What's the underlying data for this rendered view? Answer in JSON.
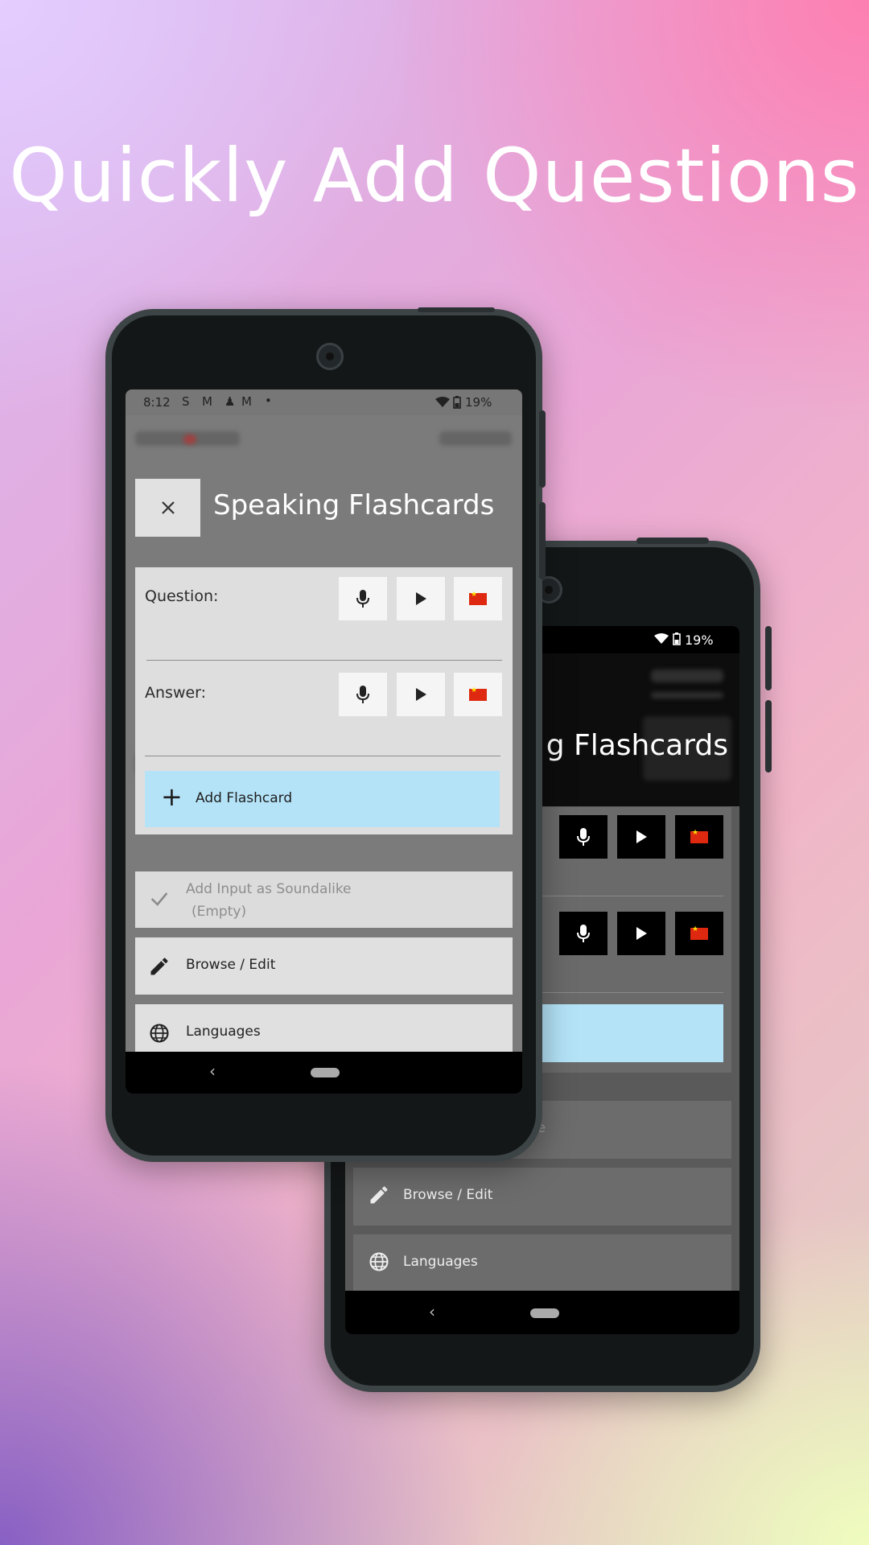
{
  "headline": "Quickly Add Questions",
  "front_phone": {
    "status_bar": {
      "time": "8:12",
      "battery": "19%"
    },
    "dialog": {
      "title": "Speaking Flashcards",
      "question_label": "Question:",
      "answer_label": "Answer:",
      "add_button_label": "Add Flashcard"
    },
    "menu": {
      "soundalike_label": "Add Input as Soundalike",
      "soundalike_sub": "(Empty)",
      "browse_label": "Browse / Edit",
      "languages_label": "Languages"
    }
  },
  "back_phone": {
    "status_bar": {
      "battery": "19%"
    },
    "title_fragment": "g Flashcards",
    "soundalike_fragment": "like",
    "browse_label": "Browse / Edit",
    "languages_label": "Languages"
  },
  "colors": {
    "add_button": "#b4e3f8",
    "flag_red": "#de2910",
    "flag_star": "#ffde00"
  },
  "icons": [
    "close-icon",
    "mic-icon",
    "play-icon",
    "china-flag-icon",
    "plus-icon",
    "check-icon",
    "pencil-icon",
    "globe-icon",
    "wifi-icon",
    "battery-icon"
  ]
}
